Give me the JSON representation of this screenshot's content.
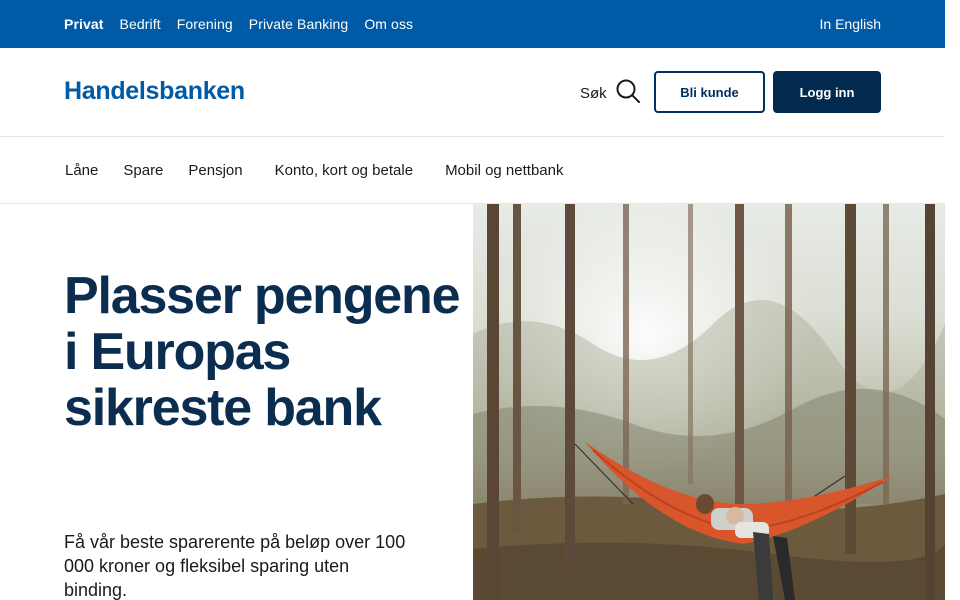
{
  "topbar": {
    "nav": [
      "Privat",
      "Bedrift",
      "Forening",
      "Private Banking",
      "Om oss"
    ],
    "language": "In English"
  },
  "header": {
    "logo": "Handelsbanken",
    "search_label": "Søk",
    "become_customer": "Bli kunde",
    "login": "Logg inn"
  },
  "mainnav": {
    "items": [
      "Låne",
      "Spare",
      "Pensjon",
      "Konto, kort og betale",
      "Mobil og nettbank"
    ]
  },
  "hero": {
    "title": "Plasser pengene i Europas sikreste bank",
    "text": "Få vår beste sparerente på beløp over 100 000 kroner og fleksibel sparing uten binding."
  },
  "colors": {
    "brand": "#005aa5",
    "navy": "#022a4e",
    "hammock": "#d9552c"
  },
  "icons": {
    "search": "search-icon"
  }
}
